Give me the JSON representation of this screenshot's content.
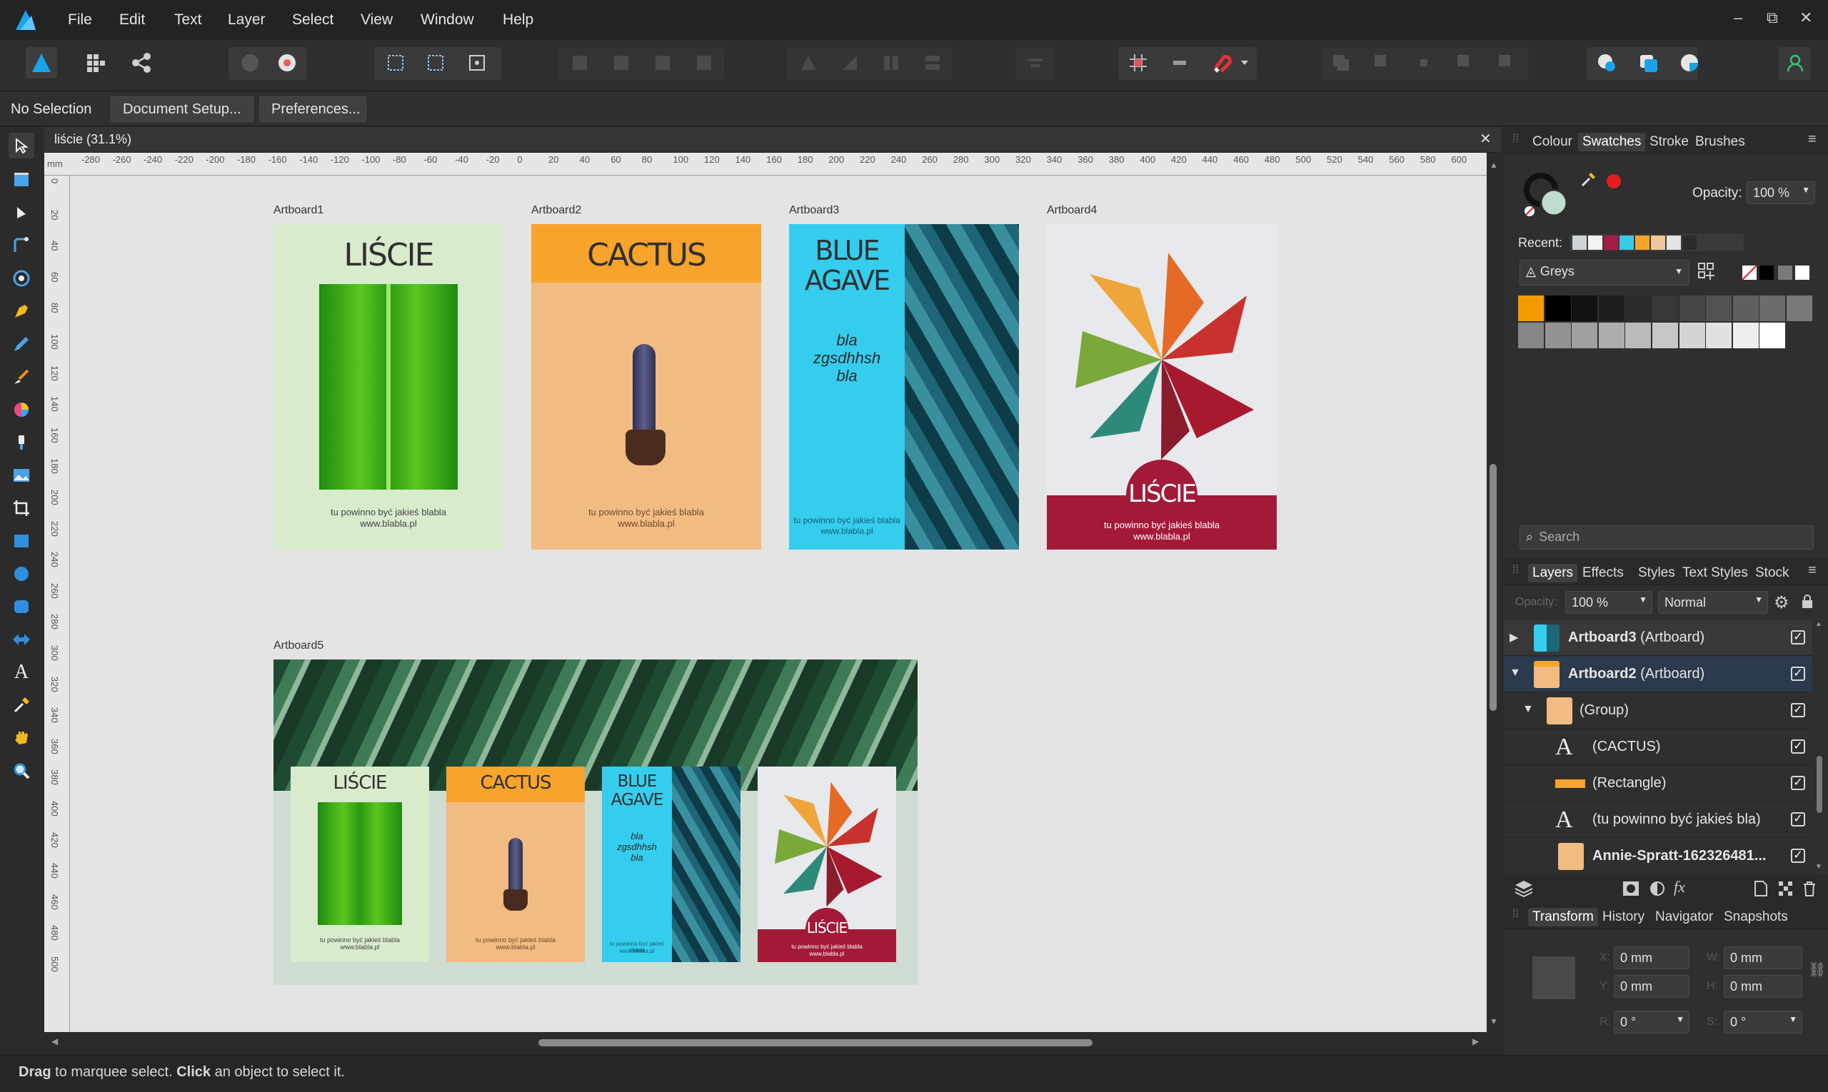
{
  "menubar": {
    "items": [
      "File",
      "Edit",
      "Text",
      "Layer",
      "Select",
      "View",
      "Window",
      "Help"
    ],
    "window_controls": [
      "‒",
      "⧉",
      "✕"
    ]
  },
  "context_bar": {
    "selection": "No Selection",
    "document_setup": "Document Setup...",
    "preferences": "Preferences..."
  },
  "document": {
    "tab_title": "liście (31.1%)",
    "ruler_unit": "mm",
    "h_ticks": [
      "-280",
      "-260",
      "-240",
      "-220",
      "-200",
      "-180",
      "-160",
      "-140",
      "-120",
      "-100",
      "-80",
      "-60",
      "-40",
      "-20",
      "0",
      "20",
      "40",
      "60",
      "80",
      "100",
      "120",
      "140",
      "160",
      "180",
      "200",
      "220",
      "240",
      "260",
      "280",
      "300",
      "320",
      "340",
      "360",
      "380",
      "400",
      "420",
      "440",
      "460",
      "480",
      "500",
      "520",
      "540",
      "560",
      "580",
      "600"
    ],
    "v_ticks": [
      "0",
      "20",
      "40",
      "60",
      "80",
      "100",
      "120",
      "140",
      "160",
      "180",
      "200",
      "220",
      "240",
      "260",
      "280",
      "300",
      "320",
      "340",
      "360",
      "380",
      "400",
      "420",
      "440",
      "460",
      "480",
      "500"
    ]
  },
  "artboards": {
    "a1": {
      "label": "Artboard1",
      "title": "LIŚCIE",
      "caption": "tu powinno być jakieś blabla",
      "url": "www.blabla.pl"
    },
    "a2": {
      "label": "Artboard2",
      "title": "CACTUS",
      "caption": "tu powinno być jakieś blabla",
      "url": "www.blabla.pl"
    },
    "a3": {
      "label": "Artboard3",
      "title_line1": "BLUE",
      "title_line2": "AGAVE",
      "body_line1": "bla",
      "body_line2": "zgsdhhsh",
      "body_line3": "bla",
      "caption": "tu powinno być jakieś blabla",
      "url": "www.blabla.pl"
    },
    "a4": {
      "label": "Artboard4",
      "title": "LIŚCIE",
      "caption": "tu powinno być jakieś blabla",
      "url": "www.blabla.pl"
    },
    "a5": {
      "label": "Artboard5",
      "t1": "LIŚCIE",
      "t2": "CACTUS",
      "t3a": "BLUE",
      "t3b": "AGAVE",
      "b1": "bla",
      "b2": "zgsdhhsh",
      "b3": "bla",
      "t4": "LIŚCIE",
      "cap": "tu powinno być jakieś blabla",
      "url": "www.blabla.pl"
    }
  },
  "status": {
    "drag": "Drag",
    "drag_text": " to marquee select. ",
    "click": "Click",
    "click_text": " an object to select it."
  },
  "colour_panel": {
    "tabs": [
      "Colour",
      "Swatches",
      "Stroke",
      "Brushes"
    ],
    "active_tab": "Swatches",
    "opacity_label": "Opacity:",
    "opacity_value": "100 %",
    "recent_label": "Recent:",
    "palette": "Greys",
    "search_placeholder": "Search",
    "recent_colors": [
      "#cfd4d6",
      "#f2f2f2",
      "#a51d46",
      "#3cc9e6",
      "#f5a52a",
      "#f0c79a",
      "#e4e4e4",
      "#2b2b2b"
    ],
    "greys": [
      "#f29a00",
      "#000000",
      "#111111",
      "#1e1e1e",
      "#2b2b2b",
      "#383838",
      "#454545",
      "#525252",
      "#5f5f5f",
      "#6c6c6c",
      "#797979",
      "#868686",
      "#939393",
      "#a0a0a0",
      "#adadad",
      "#bababa",
      "#c7c7c7",
      "#d4d4d4",
      "#e1e1e1",
      "#eeeeee",
      "#ffffff"
    ]
  },
  "layers_panel": {
    "tabs": [
      "Layers",
      "Effects",
      "Styles",
      "Text Styles",
      "Stock"
    ],
    "active_tab": "Layers",
    "opacity_label": "Opacity:",
    "opacity_value": "100 %",
    "blend_mode": "Normal",
    "rows": [
      {
        "name": "Artboard3",
        "suffix": " (Artboard)"
      },
      {
        "name": "Artboard2",
        "suffix": " (Artboard)"
      },
      {
        "name": "(Group)"
      },
      {
        "name": "(CACTUS)"
      },
      {
        "name": "(Rectangle)"
      },
      {
        "name": "(tu powinno być jakieś bla)"
      },
      {
        "name": "Annie-Spratt-162326481..."
      }
    ]
  },
  "transform_panel": {
    "tabs": [
      "Transform",
      "History",
      "Navigator",
      "Snapshots"
    ],
    "active_tab": "Transform",
    "x_label": "X:",
    "x_value": "0 mm",
    "w_label": "W:",
    "w_value": "0 mm",
    "y_label": "Y:",
    "y_value": "0 mm",
    "h_label": "H:",
    "h_value": "0 mm",
    "r_label": "R:",
    "r_value": "0 °",
    "s_label": "S:",
    "s_value": "0 °"
  }
}
